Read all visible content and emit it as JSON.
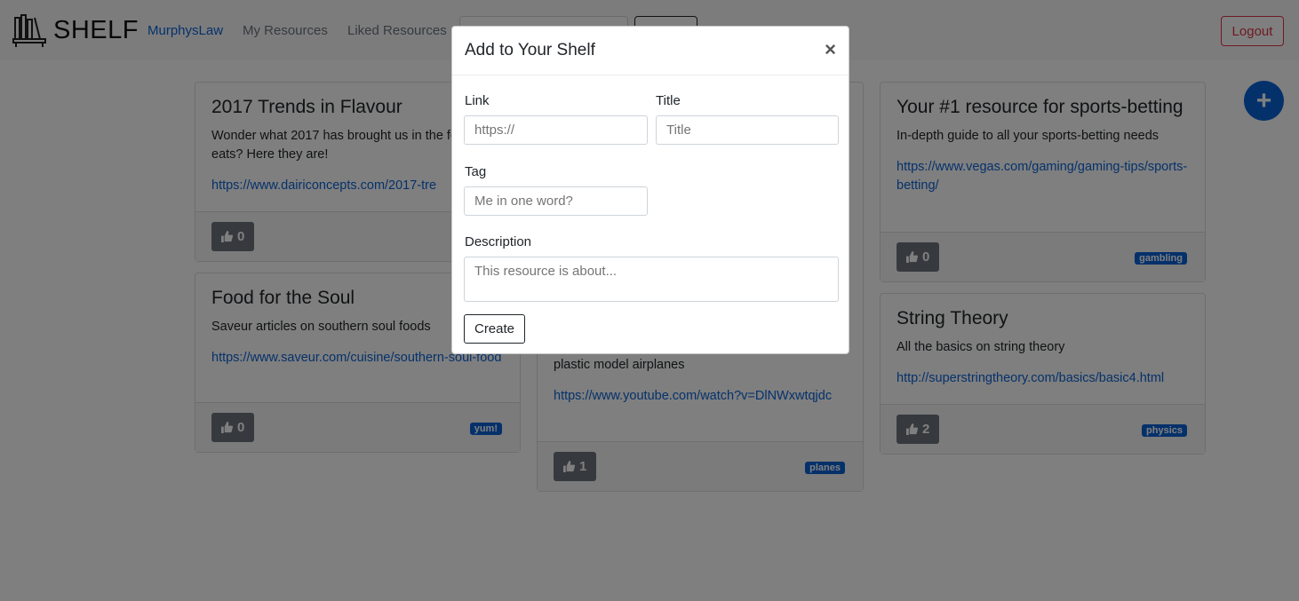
{
  "navbar": {
    "brand": "SHELF",
    "links": [
      "MurphysLaw",
      "My Resources",
      "Liked Resources"
    ],
    "logout_label": "Logout"
  },
  "cards": [
    {
      "title": "2017 Trends in Flavour",
      "description": "Wonder what 2017 has brought us in the foods and eats? Here they are!",
      "link": "https://www.dairiconcepts.com/2017-tre",
      "likes": "0",
      "tag": ""
    },
    {
      "title": "Food for the Soul",
      "description": "Saveur articles on southern soul foods",
      "link": "https://www.saveur.com/cuisine/southern-soul-food",
      "likes": "0",
      "tag": "yum!"
    },
    {
      "title": "",
      "description": "plastic model airplanes",
      "link": "https://www.youtube.com/watch?v=DlNWxwtqjdc",
      "likes": "1",
      "tag": "planes"
    },
    {
      "title": "Your #1 resource for sports-betting",
      "description": "In-depth guide to all your sports-betting needs",
      "link": "https://www.vegas.com/gaming/gaming-tips/sports-betting/",
      "likes": "0",
      "tag": "gambling"
    },
    {
      "title": "String Theory",
      "description": "All the basics on string theory",
      "link": "http://superstringtheory.com/basics/basic4.html",
      "likes": "2",
      "tag": "physics"
    }
  ],
  "fab_label": "+",
  "modal": {
    "title": "Add to Your Shelf",
    "close": "×",
    "link_label": "Link",
    "link_placeholder": "https://",
    "title_label": "Title",
    "title_placeholder": "Title",
    "tag_label": "Tag",
    "tag_placeholder": "Me in one word?",
    "description_label": "Description",
    "description_placeholder": "This resource is about...",
    "create_label": "Create"
  },
  "colors": {
    "primary": "#0b63d6",
    "danger": "#dc3545",
    "secondary": "#6c757d"
  },
  "icons": [
    "shelf-logo-icon",
    "thumbs-up-icon",
    "plus-icon",
    "close-icon"
  ]
}
